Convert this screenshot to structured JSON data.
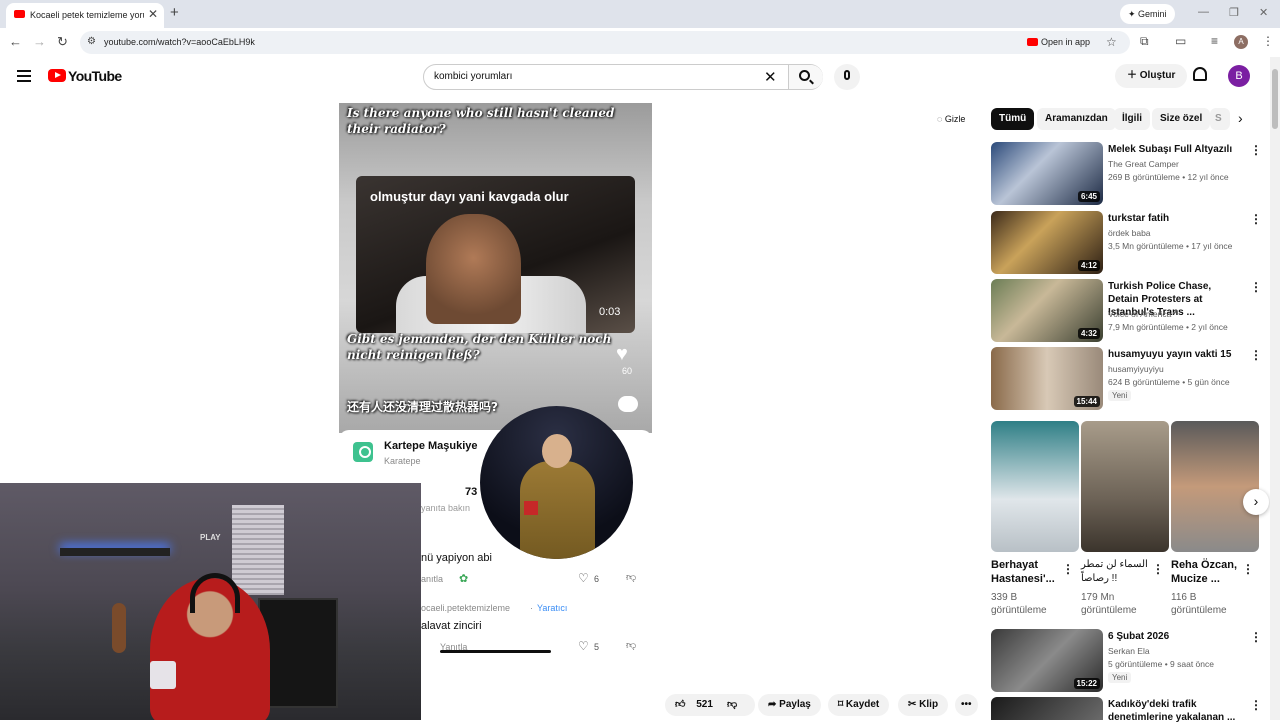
{
  "browser": {
    "tab_title": "Kocaeli petek temizleme yorum",
    "tab_close": "✕",
    "new_tab": "+",
    "gemini_label": "Gemini",
    "url": "youtube.com/watch?v=aooCaEbLH9k",
    "open_in_app": "Open in app",
    "profile_initial": "A",
    "icons": [
      "back-icon",
      "forward-icon",
      "reload-icon",
      "site-info-icon",
      "star-icon",
      "extensions-icon",
      "cast-icon",
      "reading-list-icon"
    ]
  },
  "masthead": {
    "logo_text": "YouTube",
    "search_value": "kombici yorumları",
    "create_label": "Oluştur",
    "user_initial": "B"
  },
  "video": {
    "caption_top": "Is there anyone who still hasn't cleaned their radiator?",
    "caption_de": "Gibt es jemanden, der den Kühler noch nicht reinigen ließ?",
    "caption_zh": "还有人还没清理过散热器吗?",
    "overlay_title": "olmuştur dayı yani kavgada olur",
    "overlay_time": "0:03",
    "heart_count": "60",
    "location_name": "Kartepe Maşukiye",
    "location_sub": "Karatepe",
    "comment_count": "73",
    "reply_hint": "yanıta bakın",
    "comment1_text": "nü yapiyon abi",
    "comment1_reply": "anıtla",
    "comment1_likes": "6",
    "comment2_author": "ocaeli.petektemizleme",
    "comment2_badge": "Yaratıcı",
    "comment2_text": "alavat zinciri",
    "comment2_reply": "Yanıtla",
    "comment2_likes": "5"
  },
  "actions": {
    "like_count": "521",
    "share": "Paylaş",
    "save": "Kaydet",
    "clip": "Klip",
    "more": "•••"
  },
  "sidebar": {
    "hide_label": "Gizle",
    "chips": [
      "Tümü",
      "Aramanızdan",
      "İlgili",
      "Size özel",
      "S"
    ],
    "videos": [
      {
        "title": "Melek Subaşı Full Altyazılı",
        "channel": "The Great Camper",
        "meta": "269 B görüntüleme • 12 yıl önce",
        "duration": "6:45",
        "bg": "linear-gradient(135deg,#2b4a7a,#b9c4d6 40%,#1c2a44)"
      },
      {
        "title": "turkstar fatih",
        "channel": "ördek baba",
        "meta": "3,5 Mn görüntüleme • 17 yıl önce",
        "duration": "4:12",
        "bg": "linear-gradient(135deg,#3c2a1a,#c9a25a 40%,#2d1f14)"
      },
      {
        "title": "Turkish Police Chase, Detain Protesters at Istanbul's Trans ...",
        "channel": "Voice of America",
        "meta": "7,9 Mn görüntüleme • 2 yıl önce",
        "duration": "4:32",
        "bg": "linear-gradient(135deg,#6b7d55,#c8b898 40%,#3a3f30)"
      },
      {
        "title": "husamyuyu yayın vakti 15",
        "channel": "husamyiyuyiyu",
        "meta": "624 B görüntüleme • 5 gün önce",
        "duration": "15:44",
        "badge": "Yeni",
        "bg": "linear-gradient(90deg,#8a6a4a,#d8c9b6 50%,#9a8a7a)"
      },
      {
        "title": "6 Şubat 2026",
        "channel": "Serkan Ela",
        "meta": "5 görüntüleme • 9 saat önce",
        "duration": "15:22",
        "badge": "Yeni",
        "bg": "linear-gradient(135deg,#3a3a3a,#8a8a8a 50%,#2a2a2a)"
      },
      {
        "title": "Kadıköy'deki trafik denetimlerine yakalanan ...",
        "channel": "",
        "meta": "",
        "duration": "",
        "bg": "linear-gradient(135deg,#1a1a1a,#6a6a6a)"
      }
    ],
    "shorts": [
      {
        "title": "Berhayat Hastanesi'...",
        "views": "339 B görüntüleme",
        "bg": "linear-gradient(180deg,#2f7f86,#e0e6ea 60%,#b8c0c6)"
      },
      {
        "title": "السماء لن تمطر رصاصاً !!",
        "views": "179 Mn görüntüleme",
        "bg": "linear-gradient(180deg,#a89c8a,#6c6256 60%,#3b342c)"
      },
      {
        "title": "Reha Özcan, Mucize ...",
        "views": "116 B görüntüleme",
        "bg": "linear-gradient(180deg,#5a5a5a,#c49a7a 50%,#8a8a8a)"
      }
    ]
  },
  "colors": {
    "youtube_red": "#ff0000",
    "chip_active": "#0f0f0f",
    "creator_badge": "#3a8df5"
  }
}
